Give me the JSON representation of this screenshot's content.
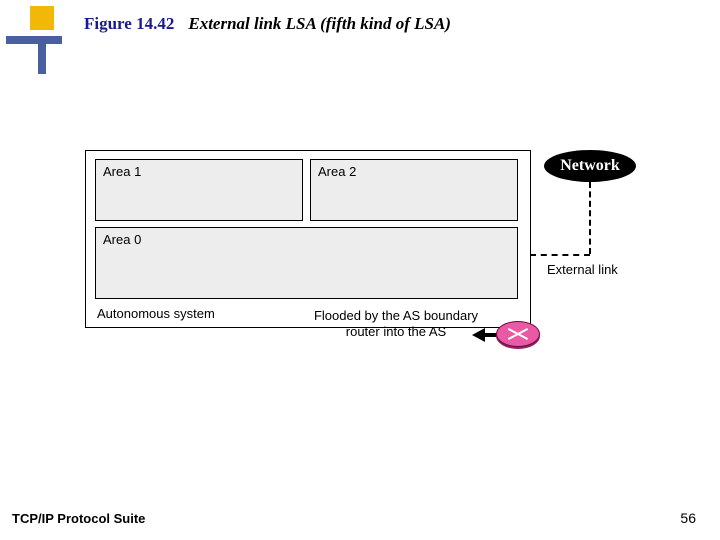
{
  "title": {
    "figure_number": "Figure 14.42",
    "caption": "External link LSA (fifth kind of LSA)"
  },
  "diagram": {
    "area1": "Area 1",
    "area2": "Area 2",
    "area0": "Area 0",
    "as_label": "Autonomous system",
    "flood_text": "Flooded by the AS boundary router into the AS",
    "network_label": "Network",
    "external_link_label": "External link"
  },
  "footer": {
    "suite": "TCP/IP Protocol Suite",
    "page": "56"
  }
}
